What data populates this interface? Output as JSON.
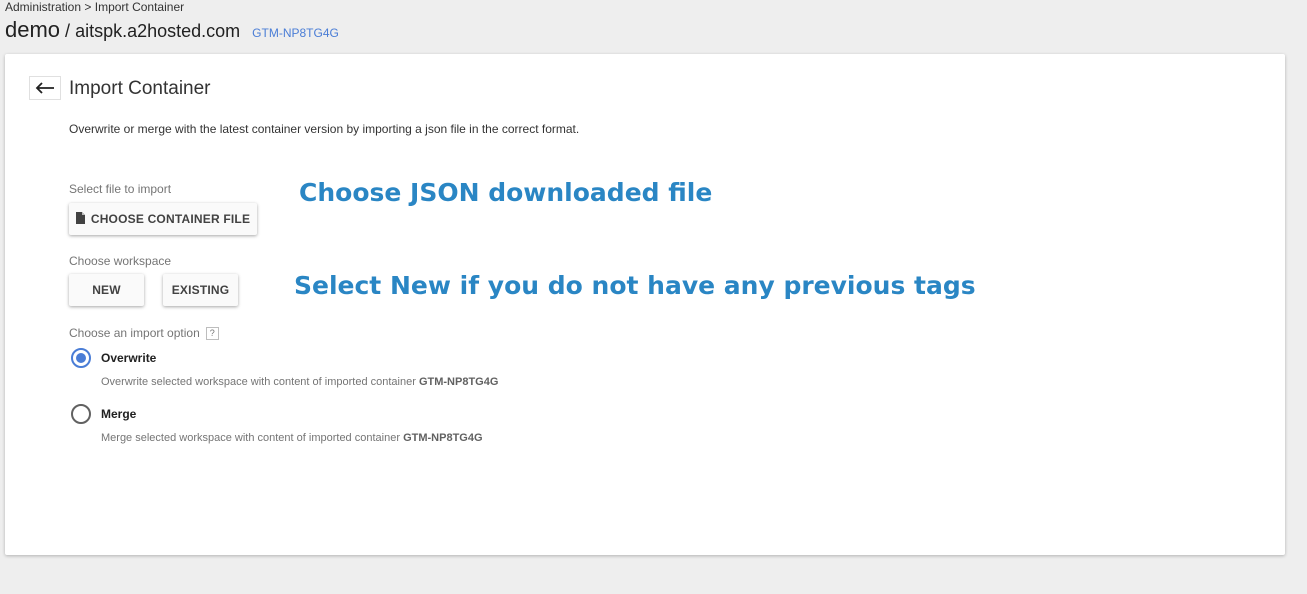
{
  "breadcrumb": {
    "admin": "Administration",
    "separator": ">",
    "current": "Import Container"
  },
  "header": {
    "account": "demo",
    "slash": "/",
    "container": "aitspk.a2hosted.com",
    "container_id": "GTM-NP8TG4G"
  },
  "card": {
    "title": "Import Container",
    "description": "Overwrite or merge with the latest container version by importing a json file in the correct format."
  },
  "file_section": {
    "label": "Select file to import",
    "button_label": "CHOOSE CONTAINER FILE",
    "icon": "file-icon"
  },
  "workspace_section": {
    "label": "Choose workspace",
    "new_label": "NEW",
    "existing_label": "EXISTING"
  },
  "import_option": {
    "label": "Choose an import option",
    "help": "?",
    "selected": "overwrite",
    "overwrite": {
      "label": "Overwrite",
      "description": "Overwrite selected workspace with content of imported container",
      "container_id": "GTM-NP8TG4G"
    },
    "merge": {
      "label": "Merge",
      "description": "Merge selected workspace with content of imported container",
      "container_id": "GTM-NP8TG4G"
    }
  },
  "annotations": {
    "file_hint": "Choose JSON downloaded file",
    "workspace_hint": "Select New if you do not have any previous tags"
  },
  "colors": {
    "accent": "#4a7dd6",
    "annotation": "#2a86c4",
    "background": "#eeeeee"
  }
}
